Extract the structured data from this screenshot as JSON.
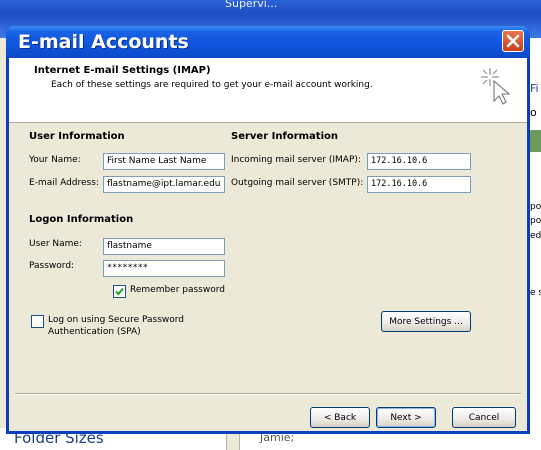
{
  "background": {
    "top_text": "Supervi...",
    "title_ghost": "Internet E-mail Settings",
    "bottom_left": "Folder Sizes",
    "bottom_right": "Jamie;",
    "right_edge_tab": "Fi",
    "right_edge_tab2": "o",
    "right_edge_lines": [
      "po",
      "po",
      "ed",
      "e s"
    ]
  },
  "dialog": {
    "title": "E-mail Accounts",
    "header": {
      "title": "Internet E-mail Settings (IMAP)",
      "subtitle": "Each of these settings are required to get your e-mail account working."
    },
    "user_info": {
      "heading": "User Information",
      "name_label": "Your Name:",
      "name_value": "First Name Last Name",
      "email_label": "E-mail Address:",
      "email_value": "flastname@ipt.lamar.edu"
    },
    "server_info": {
      "heading": "Server Information",
      "incoming_label": "Incoming mail server (IMAP):",
      "incoming_value": "172.16.10.6",
      "outgoing_label": "Outgoing mail server (SMTP):",
      "outgoing_value": "172.16.10.6"
    },
    "logon_info": {
      "heading": "Logon Information",
      "username_label": "User Name:",
      "username_value": "flastname",
      "password_label": "Password:",
      "password_value": "********",
      "remember_label": "Remember password",
      "remember_checked": true,
      "spa_label_line1": "Log on using Secure Password",
      "spa_label_line2": "Authentication (SPA)",
      "spa_checked": false
    },
    "more_settings_label": "More Settings ...",
    "buttons": {
      "back": "< Back",
      "next": "Next >",
      "cancel": "Cancel"
    }
  },
  "colors": {
    "titlebar": "#0f55dd",
    "dialog_bg": "#ece9d8",
    "close": "#c8401d"
  }
}
